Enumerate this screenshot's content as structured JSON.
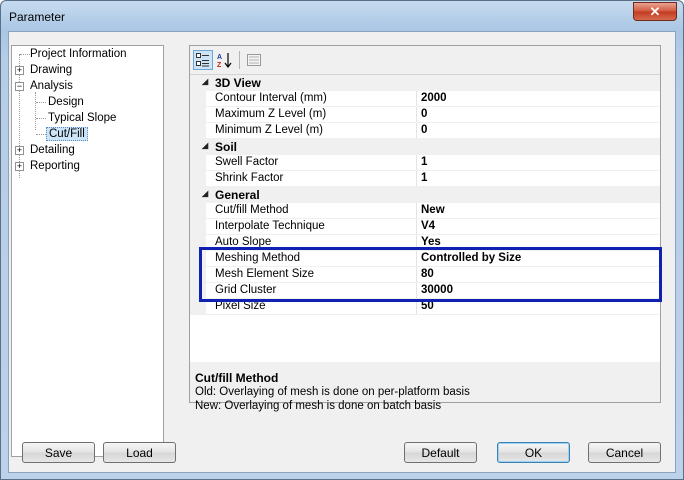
{
  "window": {
    "title": "Parameter",
    "close_glyph": "✕"
  },
  "tree": {
    "items": [
      {
        "label": "Project Information",
        "expander": ""
      },
      {
        "label": "Drawing",
        "expander": "+"
      },
      {
        "label": "Analysis",
        "expander": "−"
      },
      {
        "label": "Design",
        "expander": ""
      },
      {
        "label": "Typical Slope",
        "expander": ""
      },
      {
        "label": "Cut/Fill",
        "expander": "",
        "selected": true
      },
      {
        "label": "Detailing",
        "expander": "+"
      },
      {
        "label": "Reporting",
        "expander": "+"
      }
    ]
  },
  "toolbar": {
    "categorized_icon": "categorized-icon",
    "alphabetical_icon": "sort-az-icon",
    "property_pages_icon": "property-pages-icon"
  },
  "grid": {
    "categories": [
      {
        "label": "3D View",
        "properties": [
          {
            "name": "Contour Interval (mm)",
            "value": "2000"
          },
          {
            "name": "Maximum Z Level (m)",
            "value": "0"
          },
          {
            "name": "Minimum Z Level (m)",
            "value": "0"
          }
        ]
      },
      {
        "label": "Soil",
        "properties": [
          {
            "name": "Swell Factor",
            "value": "1"
          },
          {
            "name": "Shrink Factor",
            "value": "1"
          }
        ]
      },
      {
        "label": "General",
        "properties": [
          {
            "name": "Cut/fill Method",
            "value": "New"
          },
          {
            "name": "Interpolate Technique",
            "value": "V4"
          },
          {
            "name": "Auto Slope",
            "value": "Yes"
          },
          {
            "name": "Meshing Method",
            "value": "Controlled by Size"
          },
          {
            "name": "Mesh Element Size",
            "value": "80"
          },
          {
            "name": "Grid Cluster",
            "value": "30000"
          },
          {
            "name": "Pixel Size",
            "value": "50"
          }
        ]
      }
    ]
  },
  "description": {
    "title": "Cut/fill Method",
    "line1": "Old: Overlaying of mesh is done on per-platform basis",
    "line2": "New: Overlaying of mesh is done on batch basis"
  },
  "buttons": {
    "save": "Save",
    "load": "Load",
    "default": "Default",
    "ok": "OK",
    "cancel": "Cancel"
  },
  "colors": {
    "highlight_box": "#1020b0",
    "selection": "#cce4f7"
  }
}
